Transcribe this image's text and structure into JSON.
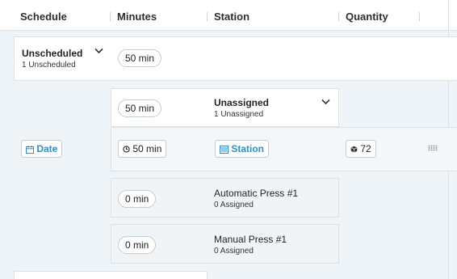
{
  "header": {
    "columns": [
      "Schedule",
      "Minutes",
      "Station",
      "Quantity"
    ]
  },
  "group": {
    "title": "Unscheduled",
    "subtitle": "1 Unscheduled",
    "minutes": "50 min"
  },
  "unassigned": {
    "minutes": "50 min",
    "title": "Unassigned",
    "subtitle": "1 Unassigned"
  },
  "order": {
    "date_label": "Date",
    "minutes": "50 min",
    "station_label": "Station",
    "quantity": "72"
  },
  "stations": [
    {
      "minutes": "0 min",
      "name": "Automatic Press #1",
      "assigned": "0 Assigned"
    },
    {
      "minutes": "0 min",
      "name": "Manual Press #1",
      "assigned": "0 Assigned"
    }
  ],
  "colors": {
    "accent": "#2f8fd1",
    "background": "#eef4f7"
  },
  "icons": [
    "chevron-down-icon",
    "calendar-icon",
    "clock-icon",
    "box-icon",
    "drag-handle-icon"
  ]
}
